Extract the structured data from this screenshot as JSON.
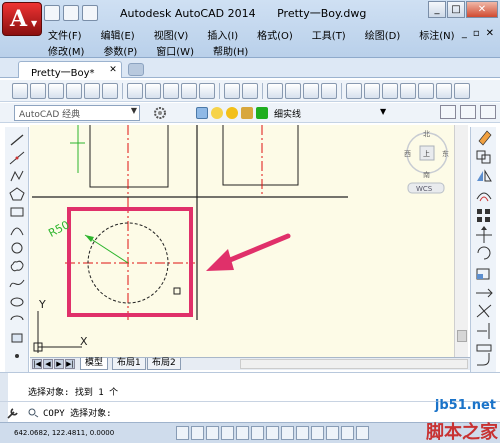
{
  "window": {
    "app_name": "Autodesk AutoCAD 2014",
    "file_name": "Pretty一Boy.dwg",
    "controls": [
      "_",
      "□",
      "✕"
    ]
  },
  "menu": {
    "row1": [
      "文件(F)",
      "编辑(E)",
      "视图(V)",
      "插入(I)",
      "格式(O)",
      "工具(T)",
      "绘图(D)",
      "标注(N)"
    ],
    "row2": [
      "修改(M)",
      "参数(P)",
      "窗口(W)",
      "帮助(H)"
    ],
    "doc_controls": [
      "_",
      "▫",
      "✕"
    ]
  },
  "tabs": {
    "file_tab": "Pretty一Boy*",
    "close": "✕"
  },
  "toolbar2": {
    "workspace": "AutoCAD 经典",
    "layer_name": "细实线"
  },
  "canvas": {
    "dimension_label": "R50",
    "ucs_y": "Y",
    "ucs_x": "X",
    "viewcube": {
      "north": "北",
      "south": "南",
      "east": "东",
      "west": "西",
      "top": "上",
      "wcs": "WCS"
    }
  },
  "layout_tabs": {
    "nav": [
      "|◀",
      "◀",
      "▶",
      "▶|"
    ],
    "tabs": [
      "模型",
      "布局1",
      "布局2"
    ]
  },
  "command": {
    "history": "选择对象: 找到 1 个",
    "prompt": "COPY 选择对象:"
  },
  "status": {
    "coords": "642.0682, 122.4811, 0.0000"
  },
  "watermark": {
    "url": "jb51.net",
    "text": "脚本之家"
  },
  "colors": {
    "canvas_bg": "#fdfbe7",
    "highlight": "#e0306a",
    "center_line": "#e01010",
    "dimension": "#2db52d"
  }
}
